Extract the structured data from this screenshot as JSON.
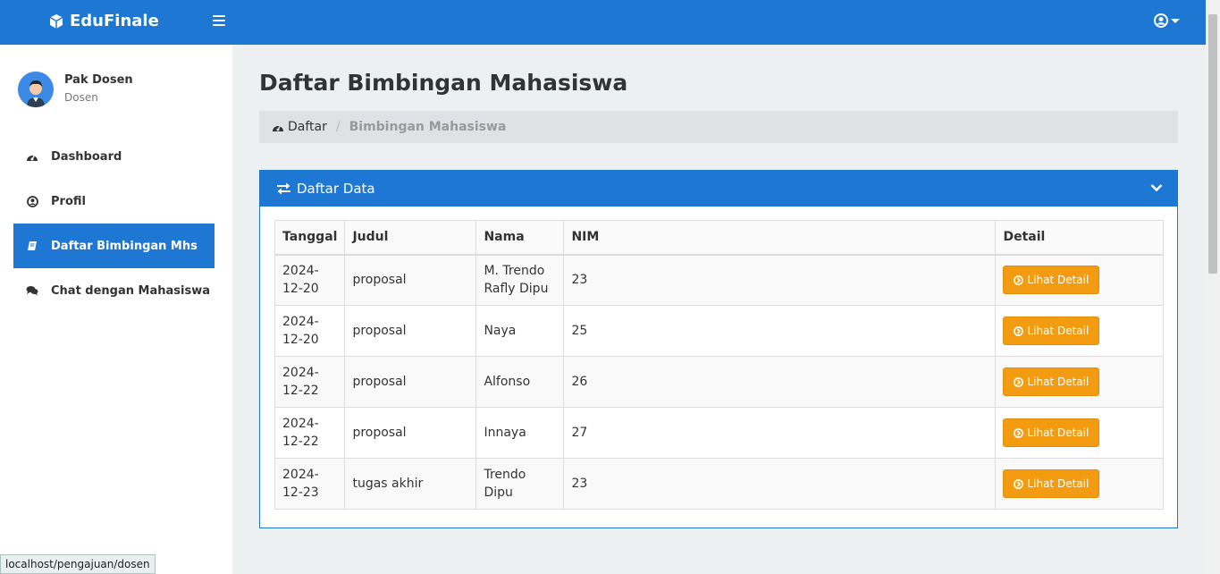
{
  "app": {
    "brand": "EduFinale"
  },
  "user": {
    "name": "Pak Dosen",
    "role": "Dosen"
  },
  "sidebar": {
    "items": [
      {
        "label": "Dashboard",
        "icon": "dashboard-icon",
        "active": false
      },
      {
        "label": "Profil",
        "icon": "user-circle-icon",
        "active": false
      },
      {
        "label": "Daftar Bimbingan Mhs",
        "icon": "book-icon",
        "active": true
      },
      {
        "label": "Chat dengan Mahasiswa",
        "icon": "comments-icon",
        "active": false
      }
    ]
  },
  "page": {
    "title": "Daftar Bimbingan Mahasiswa"
  },
  "breadcrumb": {
    "home": "Daftar",
    "separator": "/",
    "current": "Bimbingan Mahasiswa"
  },
  "panel": {
    "title": "Daftar Data"
  },
  "table": {
    "headers": [
      "Tanggal",
      "Judul",
      "Nama",
      "NIM",
      "Detail"
    ],
    "button_label": "Lihat Detail",
    "rows": [
      {
        "tanggal": "2024-12-20",
        "judul": "proposal",
        "nama": "M. Trendo Rafly Dipu",
        "nim": "23"
      },
      {
        "tanggal": "2024-12-20",
        "judul": "proposal",
        "nama": "Naya",
        "nim": "25"
      },
      {
        "tanggal": "2024-12-22",
        "judul": "proposal",
        "nama": "Alfonso",
        "nim": "26"
      },
      {
        "tanggal": "2024-12-22",
        "judul": "proposal",
        "nama": "Innaya",
        "nim": "27"
      },
      {
        "tanggal": "2024-12-23",
        "judul": "tugas akhir",
        "nama": "Trendo Dipu",
        "nim": "23"
      }
    ]
  },
  "status_bar": {
    "url": "localhost/pengajuan/dosen"
  },
  "colors": {
    "primary": "#1e78d3",
    "warning": "#f39c12",
    "background": "#ecf0f1"
  }
}
